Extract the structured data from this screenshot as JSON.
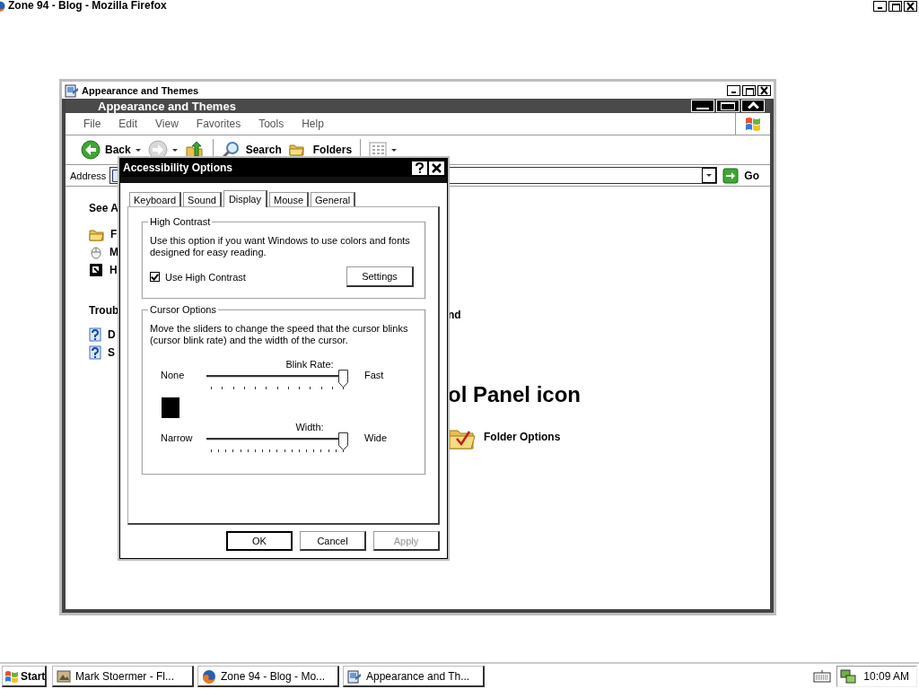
{
  "browser_titlebar": {
    "title": "Zone 94 - Blog - Mozilla Firefox"
  },
  "explorer": {
    "title": "Appearance and Themes",
    "banner": "Appearance and Themes",
    "menu": [
      "File",
      "Edit",
      "View",
      "Favorites",
      "Tools",
      "Help"
    ],
    "toolbar": [
      {
        "kind": "back",
        "label": "Back"
      },
      {
        "kind": "forward"
      },
      {
        "kind": "up"
      },
      {
        "kind": "search",
        "label": "Search"
      },
      {
        "kind": "folders",
        "label": "Folders"
      },
      {
        "kind": "views"
      }
    ],
    "address": {
      "label": "Address",
      "go": "Go"
    },
    "see_also": {
      "heading": "See A",
      "items": [
        {
          "kind": "folder",
          "label": "F"
        },
        {
          "kind": "mouse",
          "label": "M"
        },
        {
          "kind": "contrast",
          "label": "H"
        }
      ]
    },
    "troubleshooters": {
      "heading": "Troub",
      "items": [
        {
          "kind": "help",
          "label": "D"
        },
        {
          "kind": "help",
          "label": "S"
        }
      ]
    },
    "task_text": "nd",
    "section_heading": "ol Panel icon",
    "icons": [
      {
        "kind": "folder-options",
        "label": "Folder Options"
      }
    ]
  },
  "dialog": {
    "title": "Accessibility Options",
    "tabs": [
      {
        "label": "Keyboard",
        "selected": false
      },
      {
        "label": "Sound",
        "selected": false
      },
      {
        "label": "Display",
        "selected": true
      },
      {
        "label": "Mouse",
        "selected": false
      },
      {
        "label": "General",
        "selected": false
      }
    ],
    "high_contrast": {
      "legend": "High Contrast",
      "description": "Use this option if you want Windows to use colors and fonts designed for easy reading.",
      "checkbox": {
        "label": "Use High Contrast",
        "checked": true
      },
      "settings_button": "Settings"
    },
    "cursor_options": {
      "legend": "Cursor Options",
      "description": "Move the sliders to change the speed that the cursor blinks (cursor blink rate) and the width of the cursor.",
      "sliders": [
        {
          "label": "Blink Rate:",
          "min_label": "None",
          "max_label": "Fast",
          "level": 1
        },
        {
          "label": "Width:",
          "min_label": "Narrow",
          "max_label": "Wide",
          "level": 1
        }
      ]
    },
    "buttons": [
      {
        "label": "OK",
        "default": true,
        "disabled": false
      },
      {
        "label": "Cancel",
        "default": false,
        "disabled": false
      },
      {
        "label": "Apply",
        "default": false,
        "disabled": true
      }
    ]
  },
  "taskbar": {
    "start": "Start",
    "tasks": [
      {
        "kind": "image",
        "label": "Mark Stoermer - Fl..."
      },
      {
        "kind": "browser",
        "label": "Zone 94 - Blog - Mo..."
      },
      {
        "kind": "panel",
        "label": "Appearance and Th..."
      }
    ],
    "time": "10:09 AM"
  }
}
